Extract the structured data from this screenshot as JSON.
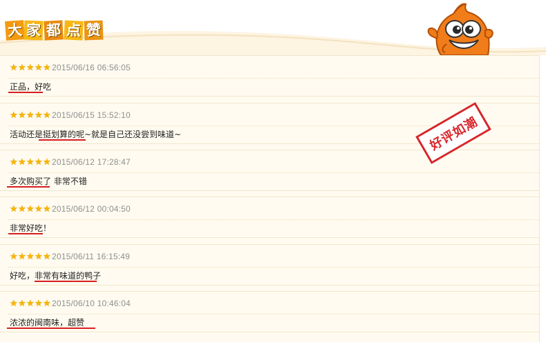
{
  "header": {
    "title_chars": [
      "大",
      "家",
      "都",
      "点",
      "赞"
    ]
  },
  "stamp": {
    "text": "好评如潮"
  },
  "reviews": [
    {
      "rating": 5,
      "date": "2015/06/16 06:56:05",
      "text": "正品，好吃"
    },
    {
      "rating": 5,
      "date": "2015/06/15 15:52:10",
      "text": "活动还是挺划算的呢~就是自己还没尝到味道~"
    },
    {
      "rating": 5,
      "date": "2015/06/12 17:28:47",
      "text": "多次购买了 非常不错"
    },
    {
      "rating": 5,
      "date": "2015/06/12 00:04:50",
      "text": "非常好吃！"
    },
    {
      "rating": 5,
      "date": "2015/06/11 16:15:49",
      "text": "好吃，非常有味道的鸭子"
    },
    {
      "rating": 5,
      "date": "2015/06/10 10:46:04",
      "text": "浓浓的闽南味，超赞"
    }
  ],
  "colors": {
    "star": "#f7b500",
    "stamp": "#d7262b",
    "underline": "#d61e1e",
    "row_background": "#fffbf0"
  },
  "icons": {
    "rating": "star-icon",
    "mascot": "cartoon-fish-mascot"
  }
}
